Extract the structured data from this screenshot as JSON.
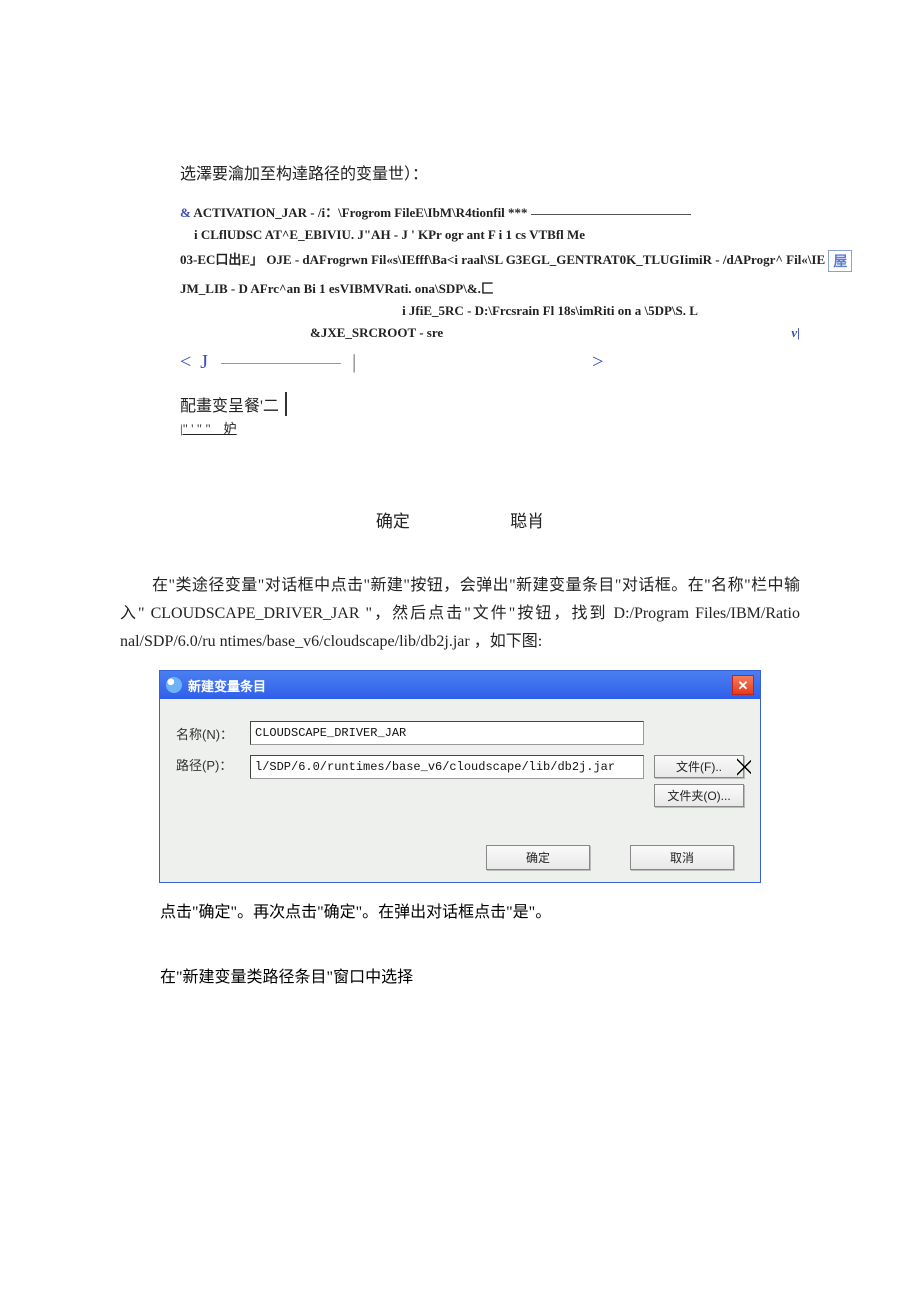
{
  "intro": "选澤要瀹加至构達路径的变量世）：",
  "vars": {
    "l1_a": "&",
    "l1_b": "ACTIVATION_JAR - /i：\\Frogrom FileE\\IbM\\R4tionfil *** ",
    "l2": "i CLflUDSC AT^E_EBIVIU. J\"AH - J ' KPr ogr ant F i 1 cs VTBfl Me",
    "l3_a": "03-EC口出E」",
    "l3_b": "OJE - dAFrogrwn Fil«s\\IEfff\\Ba<i raal\\SL G3EGL_GENTRAT0K_TLUGIimiR - /dAProgr^ Fil«\\IE",
    "l3_c": "屋",
    "l4": "JM_LIB - D AFrc^an Bi 1 esVIBMVRati. ona\\SDP\\&.匚",
    "l5": "i JfiE_5RC - D:\\Frcsrain Fl 18s\\imRiti on a \\5DP\\S. L",
    "l6_a": "&JXE_SRCROOT - sre",
    "l6_b": "v|"
  },
  "cfg_label": "配畫变呈餐'二",
  "cfg_small": "\" ' \"  \"　妒",
  "confirm_ok": "确定",
  "confirm_cancel": "聪肖",
  "para1": "在\"类途径变量\"对话框中点击\"新建\"按钮，会弹出\"新建变量条目\"对话框。在\"名称\"栏中输入\" CLOUDSCAPE_DRIVER_JAR \"，然后点击\"文件\"按钮，找到 D:/Program Files/IBM/Ratio nal/SDP/6.0/ru ntimes/base_v6/cloudscape/lib/db2j.jar ，如下图:",
  "dialog": {
    "title": "新建变量条目",
    "name_label": "名称(N)：",
    "name_value": "CLOUDSCAPE_DRIVER_JAR",
    "path_label": "路径(P)：",
    "path_value": "l/SDP/6.0/runtimes/base_v6/cloudscape/lib/db2j.jar",
    "file_btn": "文件(F)..",
    "folder_btn": "文件夹(O)...",
    "ok": "确定",
    "cancel": "取消"
  },
  "after_dlg": "点击\"确定\"。再次点击\"确定\"。在弹出对话框点击\"是\"。",
  "final": "在\"新建变量类路径条目\"窗口中选择"
}
